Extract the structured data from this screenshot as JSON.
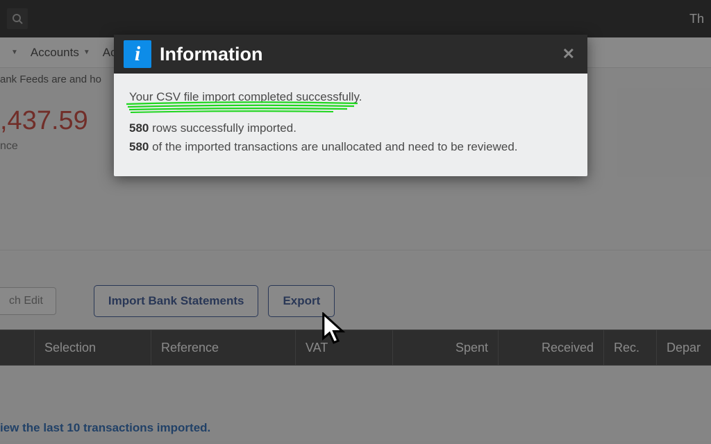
{
  "topbar": {
    "right_text": "Th"
  },
  "menu": {
    "item1_suffix": "",
    "accounts": "Accounts",
    "item3_prefix": "Ac"
  },
  "page": {
    "feeds_text": "ank Feeds are and ho",
    "balance": ",437.59",
    "balance_label": "nce",
    "import_btn": "Import Bank Statements",
    "export_btn": "Export",
    "edit_btn": "ch Edit",
    "view_last": "iew the last 10 transactions imported."
  },
  "columns": {
    "c0": "",
    "c1": "Selection",
    "c2": "Reference",
    "c3": "VAT",
    "c4": "Spent",
    "c5": "Received",
    "c6": "Rec.",
    "c7": "Depar"
  },
  "modal": {
    "title": "Information",
    "line1": "Your CSV file import completed successfully.",
    "count": "580",
    "line2_rest": " rows successfully imported.",
    "line3_rest": " of the imported transactions are unallocated and need to be reviewed."
  }
}
